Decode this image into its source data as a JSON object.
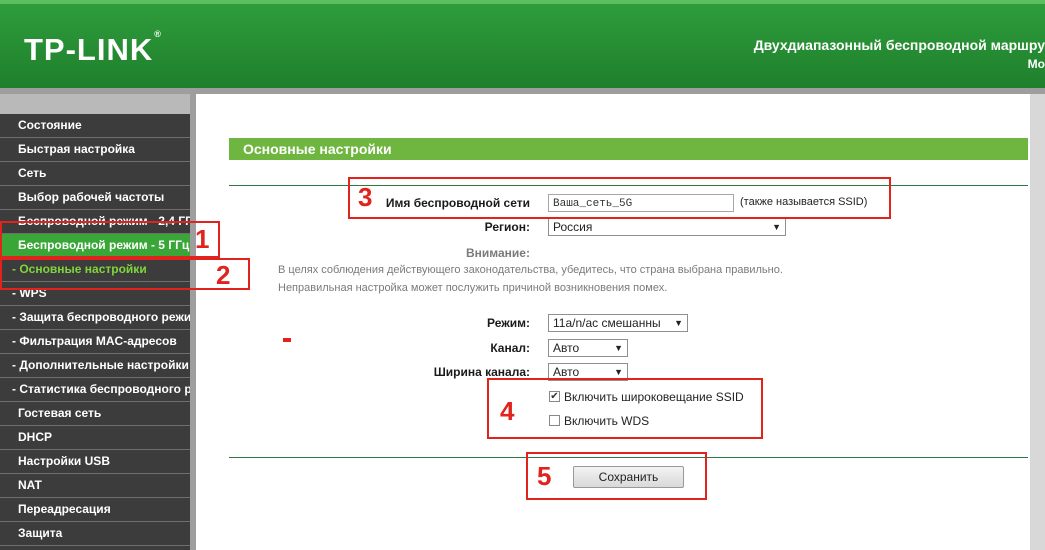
{
  "header": {
    "logo": "TP-LINK",
    "logo_mark": "®",
    "title": "Двухдиапазонный беспроводной маршру",
    "model": "Мо"
  },
  "sidebar": {
    "items": [
      {
        "label": "Состояние"
      },
      {
        "label": "Быстрая настройка"
      },
      {
        "label": "Сеть"
      },
      {
        "label": "Выбор рабочей частоты"
      },
      {
        "label": "Беспроводной режим - 2,4 ГГ"
      },
      {
        "label": "Беспроводной режим - 5 ГГц"
      },
      {
        "label": "- Основные настройки"
      },
      {
        "label": "- WPS"
      },
      {
        "label": "- Защита беспроводного режи"
      },
      {
        "label": "- Фильтрация MAC-адресов"
      },
      {
        "label": "- Дополнительные настройки"
      },
      {
        "label": "- Статистика беспроводного р"
      },
      {
        "label": "Гостевая сеть"
      },
      {
        "label": "DHCP"
      },
      {
        "label": "Настройки USB"
      },
      {
        "label": "NAT"
      },
      {
        "label": "Переадресация"
      },
      {
        "label": "Защита"
      }
    ]
  },
  "main": {
    "section_title": "Основные настройки",
    "ssid_label": "Имя беспроводной сети",
    "ssid_value": "Ваша_сеть_5G",
    "ssid_note": "(также называется SSID)",
    "region_label": "Регион:",
    "region_value": "Россия",
    "warning_label": "Внимание:",
    "warning_line1": "В целях соблюдения действующего законодательства, убедитесь, что страна выбрана правильно.",
    "warning_line2": "Неправильная настройка может послужить причиной возникновения помех.",
    "mode_label": "Режим:",
    "mode_value": "11a/n/ac смешанны",
    "channel_label": "Канал:",
    "channel_value": "Авто",
    "width_label": "Ширина канала:",
    "width_value": "Авто",
    "ssid_broadcast_label": "Включить широковещание SSID",
    "ssid_broadcast_checked": true,
    "wds_label": "Включить WDS",
    "wds_checked": false,
    "save_label": "Сохранить"
  },
  "annotations": {
    "n1": "1",
    "n2": "2",
    "n3": "3",
    "n4": "4",
    "n5": "5"
  },
  "colors": {
    "accent_green": "#3aa637",
    "annotation_red": "#e0231c"
  }
}
